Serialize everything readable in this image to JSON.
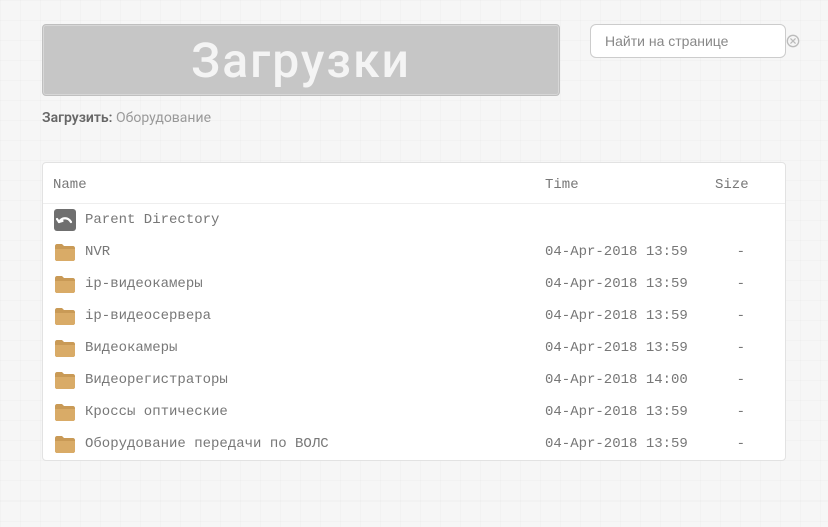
{
  "banner": {
    "title": "Загрузки"
  },
  "search": {
    "placeholder": "Найти на странице"
  },
  "breadcrumb": {
    "label": "Загрузить:",
    "path": "Оборудование"
  },
  "columns": {
    "name": "Name",
    "time": "Time",
    "size": "Size"
  },
  "parent": {
    "label": "Parent Directory"
  },
  "rows": [
    {
      "name": "NVR",
      "time": "04-Apr-2018 13:59",
      "size": "-"
    },
    {
      "name": "ip-видеокамеры",
      "time": "04-Apr-2018 13:59",
      "size": "-"
    },
    {
      "name": "ip-видеосервера",
      "time": "04-Apr-2018 13:59",
      "size": "-"
    },
    {
      "name": "Видеокамеры",
      "time": "04-Apr-2018 13:59",
      "size": "-"
    },
    {
      "name": "Видеорегистраторы",
      "time": "04-Apr-2018 14:00",
      "size": "-"
    },
    {
      "name": "Кроссы оптические",
      "time": "04-Apr-2018 13:59",
      "size": "-"
    },
    {
      "name": "Оборудование передачи по ВОЛС",
      "time": "04-Apr-2018 13:59",
      "size": "-"
    }
  ]
}
